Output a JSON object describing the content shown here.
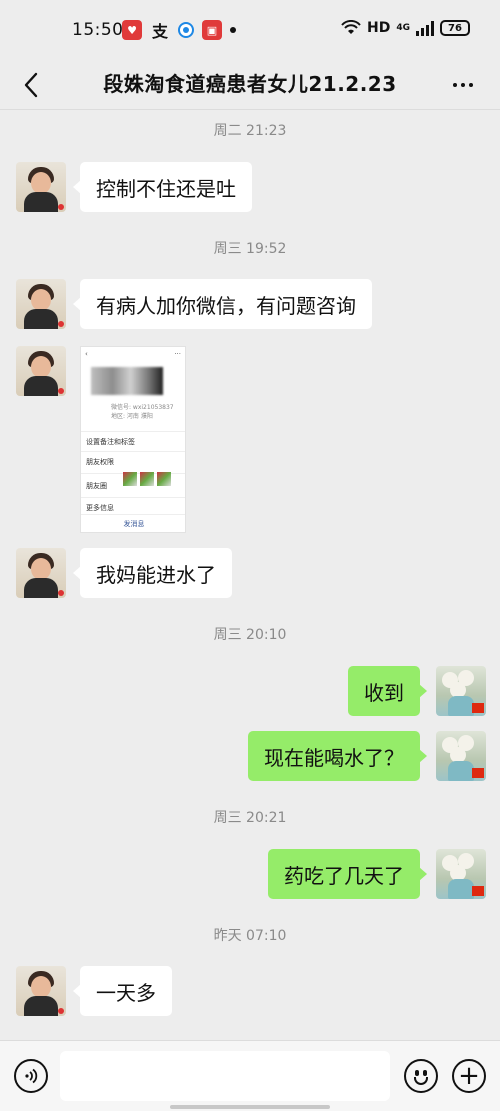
{
  "status_bar": {
    "time": "15:50",
    "app_icons": [
      "heart-app-icon",
      "zhi-app-icon",
      "circle-app-icon",
      "red-app-icon"
    ],
    "network_label": "HD",
    "cellular_label": "4G",
    "battery": "76"
  },
  "nav": {
    "title": "段姝淘食道癌患者女儿21.2.23",
    "back_icon": "chevron-left-icon",
    "more_icon": "more-dots-icon"
  },
  "messages": [
    {
      "type": "time",
      "text": "周二 21:23"
    },
    {
      "type": "in",
      "text": "控制不住还是吐"
    },
    {
      "type": "time",
      "text": "周三 19:52"
    },
    {
      "type": "in",
      "text": "有病人加你微信，有问题咨询"
    },
    {
      "type": "in-image",
      "image": {
        "id_line": "微信号: wxi21053837",
        "region_line": "地区: 河南 濮阳",
        "rows": [
          "设置备注和标签",
          "朋友权限",
          "朋友圈",
          "更多信息"
        ],
        "action": "发消息"
      }
    },
    {
      "type": "in",
      "text": "我妈能进水了"
    },
    {
      "type": "time",
      "text": "周三 20:10"
    },
    {
      "type": "out",
      "text": "收到"
    },
    {
      "type": "out",
      "text": "现在能喝水了？"
    },
    {
      "type": "time",
      "text": "周三 20:21"
    },
    {
      "type": "out",
      "text": "药吃了几天了"
    },
    {
      "type": "time",
      "text": "昨天 07:10"
    },
    {
      "type": "in",
      "text": "一天多"
    }
  ],
  "input_bar": {
    "value": "",
    "voice_icon": "voice-icon",
    "emoji_icon": "emoji-icon",
    "plus_icon": "plus-icon"
  },
  "colors": {
    "background": "#ededed",
    "bubble_in": "#ffffff",
    "bubble_out": "#95ec69",
    "timestamp": "#8a8a8a"
  }
}
